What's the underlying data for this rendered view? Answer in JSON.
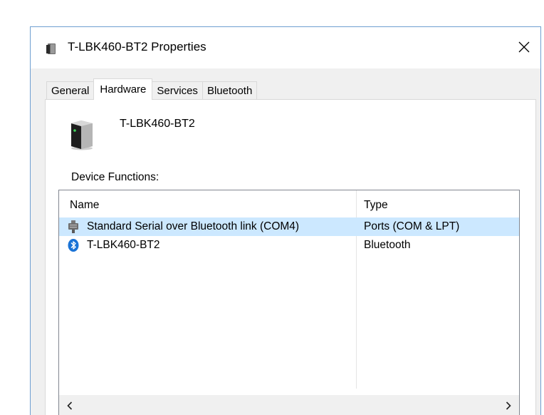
{
  "window": {
    "title": "T-LBK460-BT2 Properties",
    "accent_border": "#6f9fd1"
  },
  "tabs": [
    {
      "label": "General",
      "active": false
    },
    {
      "label": "Hardware",
      "active": true
    },
    {
      "label": "Services",
      "active": false
    },
    {
      "label": "Bluetooth",
      "active": false
    }
  ],
  "device": {
    "name": "T-LBK460-BT2",
    "icon": "printer-device-icon"
  },
  "functions": {
    "label": "Device Functions:",
    "columns": [
      "Name",
      "Type"
    ],
    "rows": [
      {
        "name": "Standard Serial over Bluetooth link (COM4)",
        "type": "Ports (COM & LPT)",
        "icon": "serial-port-icon",
        "selected": true
      },
      {
        "name": "T-LBK460-BT2",
        "type": "Bluetooth",
        "icon": "bluetooth-icon",
        "selected": false
      }
    ],
    "selection_color": "#cce8ff"
  }
}
